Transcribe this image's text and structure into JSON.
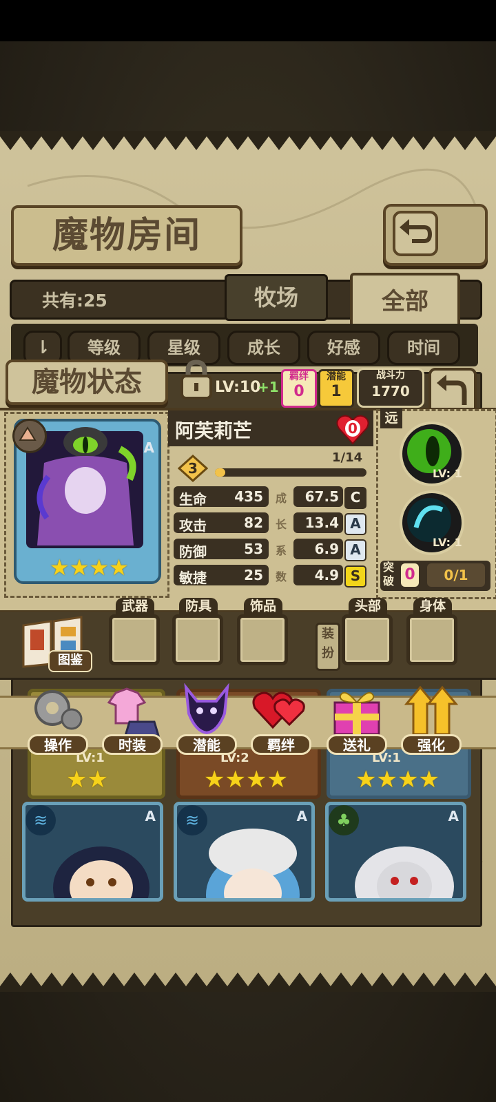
{
  "header": {
    "title": "魔物房间",
    "count": "共有:25"
  },
  "tabs": [
    {
      "label": "牧场"
    },
    {
      "label": "全部"
    }
  ],
  "sort": {
    "buttons": [
      "等级",
      "星级",
      "成长",
      "好感",
      "时间"
    ]
  },
  "status_panel": {
    "title": "魔物状态",
    "bond": {
      "label": "羁绊",
      "value": "0"
    },
    "potential": {
      "label": "潜能",
      "value": "1"
    },
    "power": {
      "label": "战斗力",
      "value": "1770"
    },
    "bg_level": "LV:10",
    "bg_plus": "+1"
  },
  "monster": {
    "name": "阿芙莉芒",
    "heart": "0",
    "rank_badge": "A",
    "stars": 4,
    "level": "3",
    "exp_text": "1/14",
    "exp_fraction": 0.07,
    "stats": [
      {
        "label": "生命",
        "value": "435",
        "growth": "67.5",
        "grade": "C"
      },
      {
        "label": "攻击",
        "value": "82",
        "growth": "13.4",
        "grade": "A"
      },
      {
        "label": "防御",
        "value": "53",
        "growth": "6.9",
        "grade": "A"
      },
      {
        "label": "敏捷",
        "value": "25",
        "growth": "4.9",
        "grade": "S"
      }
    ],
    "growth_vertical": [
      "成",
      "长",
      "系",
      "数"
    ]
  },
  "skills": {
    "range": "远",
    "items": [
      {
        "level": "LV: 1"
      },
      {
        "level": "LV: 1"
      }
    ],
    "breakthrough": {
      "label_top": "突",
      "label_bottom": "破",
      "value": "0",
      "progress": "0/1"
    }
  },
  "equipment": {
    "book_label": "图鉴",
    "dress_label": [
      "装",
      "扮"
    ],
    "slots": [
      "武器",
      "防具",
      "饰品",
      "头部",
      "身体"
    ]
  },
  "actions": [
    "操作",
    "时装",
    "潜能",
    "羁绊",
    "送礼",
    "强化"
  ],
  "grid_rows": [
    {
      "stars": [
        2,
        4,
        4
      ],
      "levels": [
        "LV:1",
        "LV:2",
        "LV:1"
      ]
    },
    {
      "badges": [
        "A",
        "A",
        "A"
      ]
    }
  ],
  "colors": {
    "gold": "#f7d21a",
    "grade_c": "#3a3022",
    "grade_a": "#dfe8f0",
    "grade_s": "#f2d51a",
    "bond_pink": "#d12b8d",
    "heart_red": "#e02030"
  }
}
